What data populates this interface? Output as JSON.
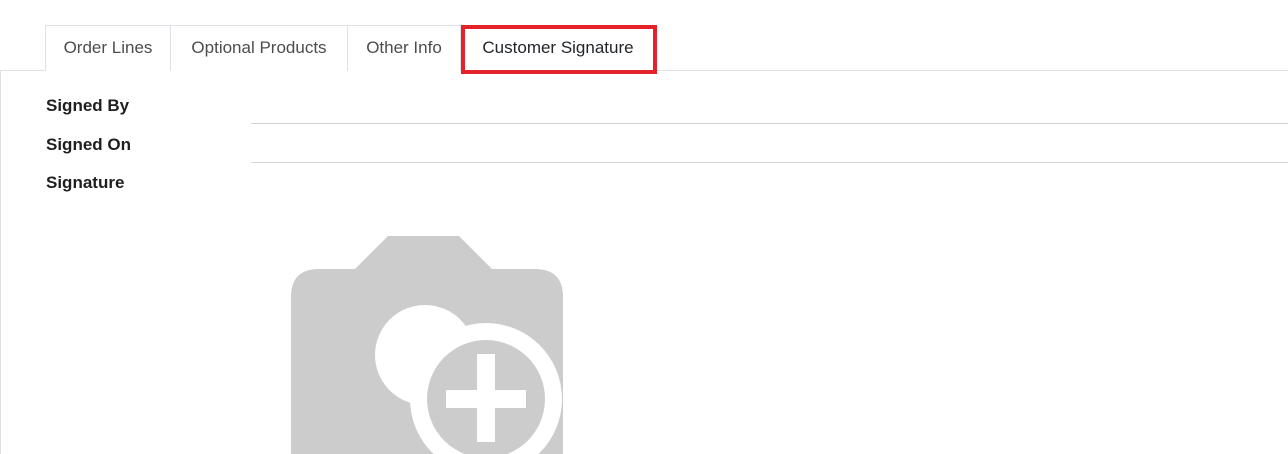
{
  "tabs": [
    {
      "label": "Order Lines",
      "active": false
    },
    {
      "label": "Optional Products",
      "active": false
    },
    {
      "label": "Other Info",
      "active": false
    },
    {
      "label": "Customer Signature",
      "active": true
    }
  ],
  "form": {
    "signed_by": {
      "label": "Signed By",
      "value": ""
    },
    "signed_on": {
      "label": "Signed On",
      "value": ""
    },
    "signature": {
      "label": "Signature",
      "icon": "camera-plus-icon"
    }
  },
  "colors": {
    "highlight": "#e3222a",
    "placeholder_icon": "#cccccc",
    "border": "#dee2e6"
  }
}
